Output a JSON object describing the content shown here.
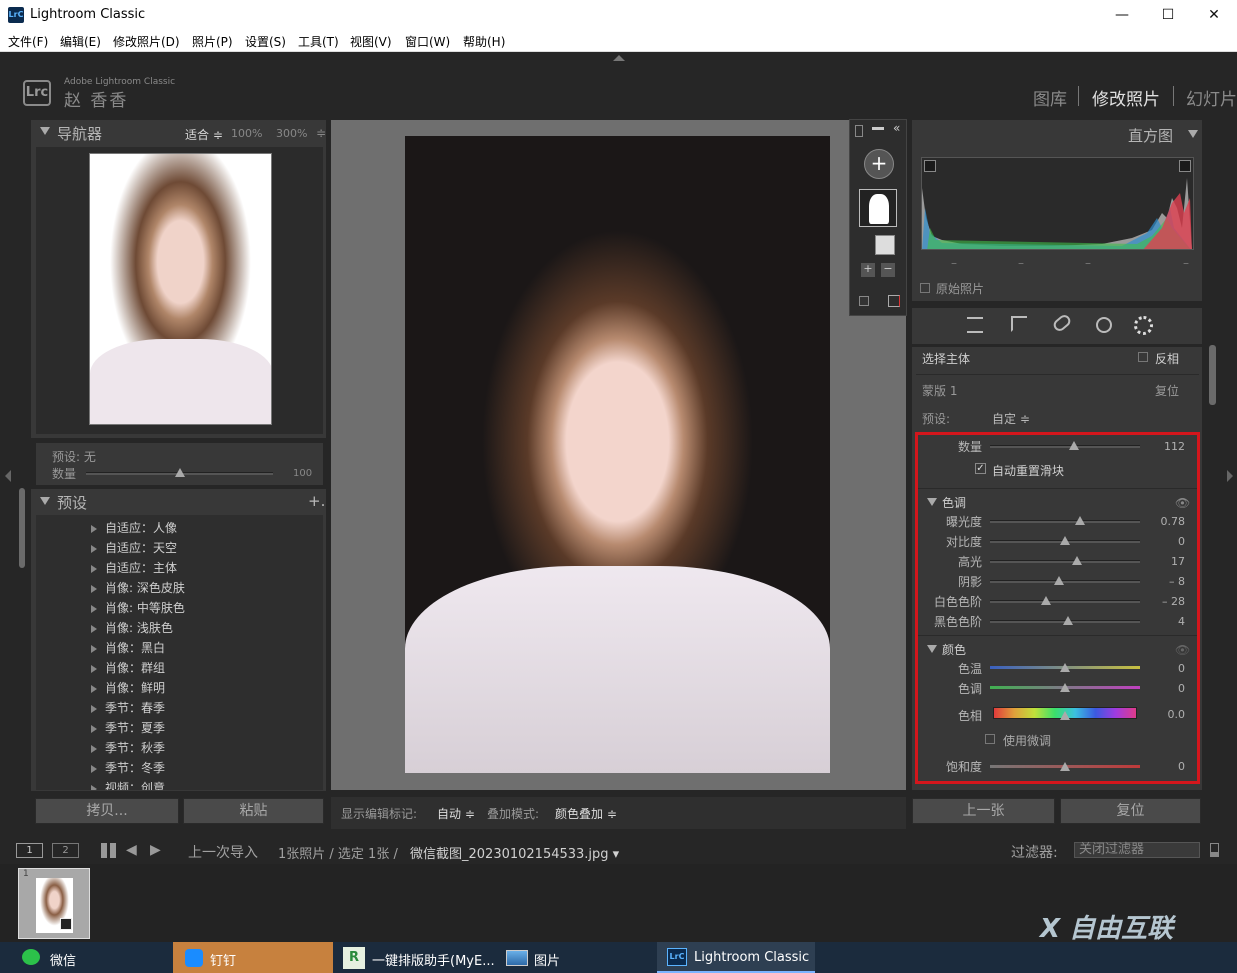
{
  "window": {
    "title": "Lightroom Classic",
    "app_icon": "LrC",
    "minimize": "—",
    "maximize": "☐",
    "close": "✕"
  },
  "menu": [
    "文件(F)",
    "编辑(E)",
    "修改照片(D)",
    "照片(P)",
    "设置(S)",
    "工具(T)",
    "视图(V)",
    "窗口(W)",
    "帮助(H)"
  ],
  "identity": {
    "badge": "Lrc",
    "small": "Adobe Lightroom Classic",
    "name": "赵 香香"
  },
  "modules": {
    "library": "图库",
    "develop": "修改照片",
    "slideshow": "幻灯片",
    "active": "修改照片"
  },
  "navigator": {
    "title": "导航器",
    "fit": "适合 ≑",
    "z100": "100%",
    "z300": "300%"
  },
  "preset_amount": {
    "preset_label": "预设: 无",
    "amount_label": "数量",
    "amount_value": "100",
    "amount_level": 0.5
  },
  "presets": {
    "title": "预设",
    "add": "+.",
    "items": [
      "自适应：人像",
      "自适应：天空",
      "自适应：主体",
      "肖像: 深色皮肤",
      "肖像: 中等肤色",
      "肖像: 浅肤色",
      "肖像：黑白",
      "肖像：群组",
      "肖像：鲜明",
      "季节：春季",
      "季节：夏季",
      "季节：秋季",
      "季节：冬季",
      "视频：创意"
    ]
  },
  "left_buttons": {
    "copy": "拷贝...",
    "paste": "粘贴"
  },
  "toolbar": {
    "edit_pins_label": "显示编辑标记:",
    "edit_pins_value": "自动 ≑",
    "overlay_label": "叠加模式:",
    "overlay_value": "颜色叠加 ≑"
  },
  "histogram": {
    "title": "直方图",
    "original": "原始照片",
    "dashes": "–"
  },
  "mask": {
    "select_subject": "选择主体",
    "invert": "反相",
    "mask_name": "蒙版 1",
    "reset": "复位",
    "preset_label": "预设:",
    "preset_value": "自定 ≑",
    "amount_label": "数量",
    "amount_value": "112",
    "amount_level": 0.56,
    "auto_reset": "自动重置滑块",
    "tone_title": "色调",
    "tone": [
      {
        "label": "曝光度",
        "value": "0.78",
        "level": 0.6
      },
      {
        "label": "对比度",
        "value": "0",
        "level": 0.5
      },
      {
        "label": "高光",
        "value": "17",
        "level": 0.58
      },
      {
        "label": "阴影",
        "value": "– 8",
        "level": 0.46
      },
      {
        "label": "白色色阶",
        "value": "– 28",
        "level": 0.37
      },
      {
        "label": "黑色色阶",
        "value": "4",
        "level": 0.52
      }
    ],
    "color_title": "颜色",
    "color": [
      {
        "label": "色温",
        "value": "0",
        "level": 0.5
      },
      {
        "label": "色调",
        "value": "0",
        "level": 0.5
      },
      {
        "label": "色相",
        "value": "0.0",
        "level": 0.5
      }
    ],
    "fine_adjust": "使用微调",
    "saturation_label": "饱和度",
    "saturation_value": "0",
    "saturation_level": 0.5
  },
  "right_buttons": {
    "previous": "上一张",
    "reset": "复位"
  },
  "filmstrip": {
    "view1": "1",
    "view2": "2",
    "source": "上一次导入",
    "count": "1张照片 / 选定 1张 /",
    "filename": "微信截图_20230102154533.jpg ▾",
    "filter_label": "过滤器:",
    "filter_value": "关闭过滤器",
    "thumb_index": "1"
  },
  "taskbar": [
    {
      "label": "微信",
      "icon": "wechat-icon"
    },
    {
      "label": "钉钉",
      "icon": "dingtalk-icon"
    },
    {
      "label": "一键排版助手(MyE...",
      "icon": "typeset-icon"
    },
    {
      "label": "图片",
      "icon": "photos-icon"
    },
    {
      "label": "Lightroom Classic",
      "icon": "lrc-icon"
    }
  ],
  "colors": {
    "highlight_border": "#d4161c",
    "panel": "#383838",
    "taskbar_active": "#c7813e"
  }
}
